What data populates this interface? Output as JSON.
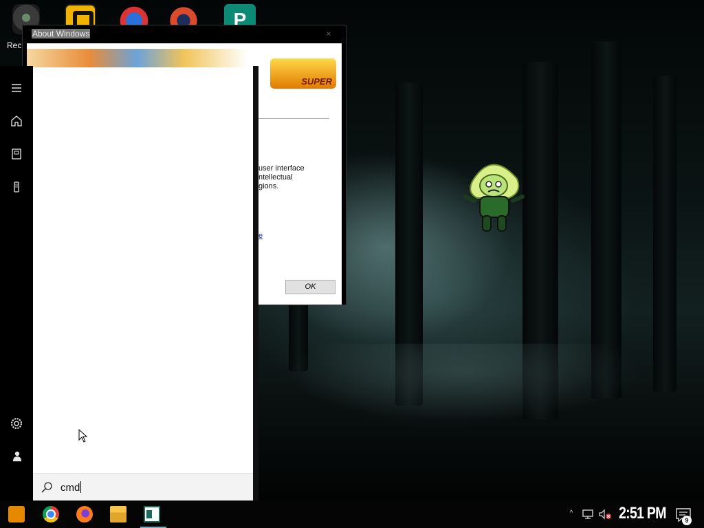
{
  "desktop": {
    "recycle_label": "Rec"
  },
  "about_dialog": {
    "title": "About Windows",
    "close_glyph": "×",
    "logo_text": "SUPER",
    "text_lines": [
      "user interface",
      "ntellectual",
      "gions."
    ],
    "link_text": "e",
    "ok_label": "OK"
  },
  "start_menu": {
    "rail_icons": [
      "hamburger-menu-icon",
      "home-icon",
      "documents-icon",
      "device-icon",
      "settings-icon",
      "user-icon"
    ],
    "search_value": "cmd"
  },
  "taskbar": {
    "apps": [
      "dbz-app-icon",
      "chrome-icon",
      "firefox-icon",
      "file-explorer-icon",
      "publisher-icon"
    ],
    "tray_chevron": "^",
    "clock": "2:51 PM",
    "notification_count": "9"
  },
  "colors": {
    "start_panel_bg": "#ffffff",
    "search_bar_bg": "#f3f3f3",
    "taskbar_bg": "#050505"
  }
}
